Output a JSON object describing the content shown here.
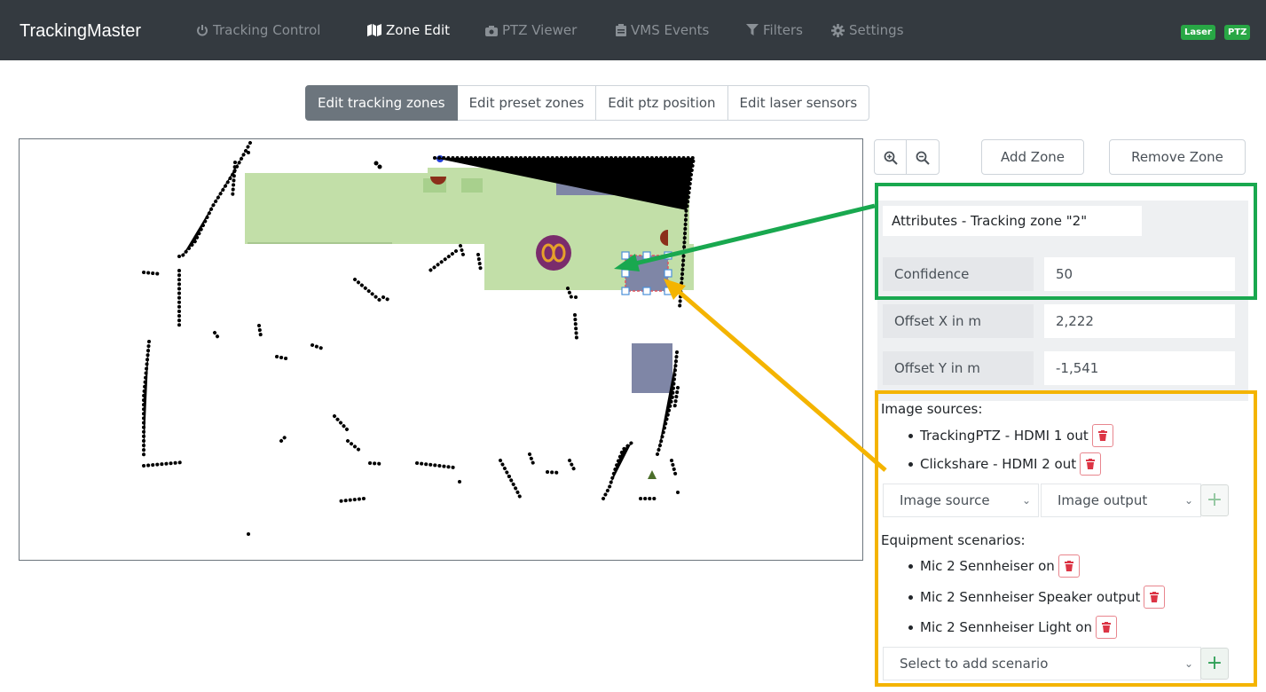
{
  "navbar": {
    "brand": "TrackingMaster",
    "items": [
      {
        "label": "Tracking Control",
        "icon": "power-icon"
      },
      {
        "label": "Zone Edit",
        "icon": "map-icon"
      },
      {
        "label": "PTZ Viewer",
        "icon": "camera-icon"
      },
      {
        "label": "VMS Events",
        "icon": "clipboard-icon"
      },
      {
        "label": "Filters",
        "icon": "filter-icon"
      },
      {
        "label": "Settings",
        "icon": "gear-icon"
      }
    ],
    "active_item": "Zone Edit",
    "badges": [
      "Laser",
      "PTZ"
    ]
  },
  "tabs": [
    {
      "label": "Edit tracking zones",
      "active": true
    },
    {
      "label": "Edit preset zones",
      "active": false
    },
    {
      "label": "Edit ptz position",
      "active": false
    },
    {
      "label": "Edit laser sensors",
      "active": false
    }
  ],
  "toolbar": {
    "zoom_in_icon": "zoom-in-icon",
    "zoom_out_icon": "zoom-out-icon",
    "add_zone": "Add Zone",
    "remove_zone": "Remove Zone"
  },
  "attributes": {
    "title": "Attributes - Tracking zone \"2\"",
    "fields": [
      {
        "label": "Confidence",
        "value": "50"
      },
      {
        "label": "Offset X in m",
        "value": "2,222"
      },
      {
        "label": "Offset Y in m",
        "value": "-1,541"
      }
    ]
  },
  "image_sources": {
    "heading": "Image sources:",
    "items": [
      "TrackingPTZ - HDMI 1 out",
      "Clickshare - HDMI 2 out"
    ],
    "source_select": "Image source",
    "output_select": "Image output"
  },
  "equipment": {
    "heading": "Equipment scenarios:",
    "items": [
      "Mic 2 Sennheiser on",
      "Mic 2 Sennheiser Speaker output",
      "Mic 2 Sennheiser Light on"
    ],
    "select": "Select to add scenario"
  },
  "colors": {
    "navbar": "#343a40",
    "zone_green": "#c2dfa8",
    "zone_blue": "#7f86a6",
    "highlight_green": "#19a84f",
    "highlight_yellow": "#f4b400",
    "trash_red": "#dc3545"
  }
}
